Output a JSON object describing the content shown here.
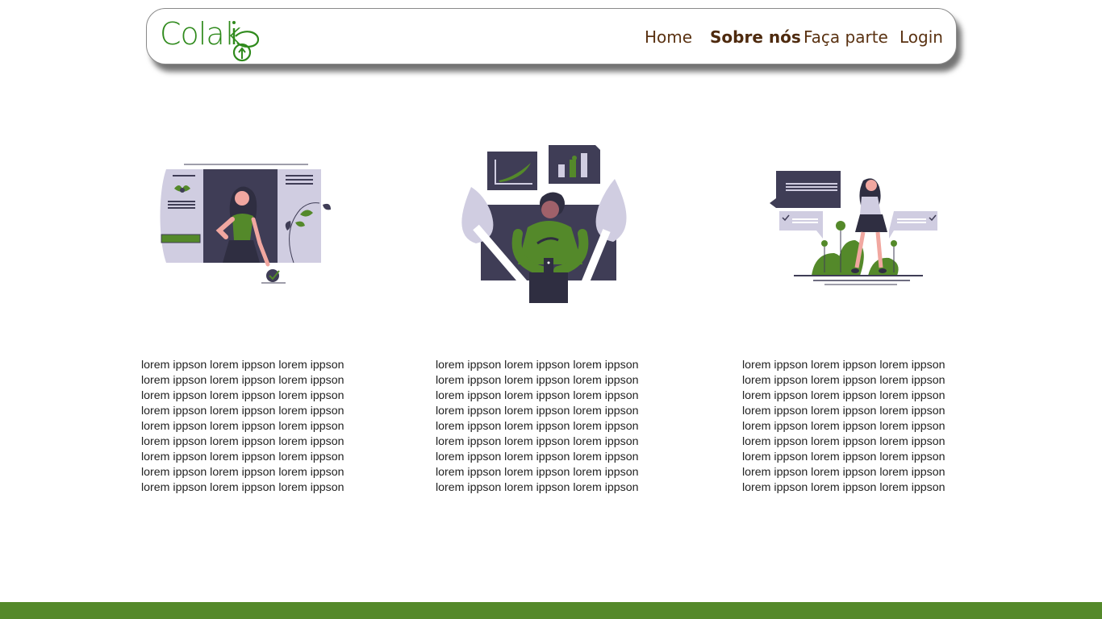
{
  "brand": {
    "name": "Colaki",
    "color": "#2f8a1c"
  },
  "nav": {
    "items": [
      {
        "label": "Home",
        "active": false
      },
      {
        "label": "Sobre nós",
        "active": true
      },
      {
        "label": "Faça parte",
        "active": false
      },
      {
        "label": "Login",
        "active": false
      }
    ]
  },
  "sections": [
    {
      "illustration": "woman-at-window-with-plant",
      "lines": [
        "lorem ippson lorem ippson lorem ippson",
        "lorem ippson lorem ippson lorem ippson",
        "lorem ippson lorem ippson lorem ippson",
        "lorem ippson lorem ippson lorem ippson",
        "lorem ippson lorem ippson lorem ippson",
        "lorem ippson lorem ippson lorem ippson",
        "lorem ippson lorem ippson lorem ippson",
        "lorem ippson lorem ippson lorem ippson",
        "lorem ippson lorem ippson lorem ippson"
      ]
    },
    {
      "illustration": "man-with-phone-and-charts",
      "lines": [
        "lorem ippson lorem ippson lorem ippson",
        "lorem ippson lorem ippson lorem ippson",
        "lorem ippson lorem ippson lorem ippson",
        "lorem ippson lorem ippson lorem ippson",
        "lorem ippson lorem ippson lorem ippson",
        "lorem ippson lorem ippson lorem ippson",
        "lorem ippson lorem ippson lorem ippson",
        "lorem ippson lorem ippson lorem ippson",
        "lorem ippson lorem ippson lorem ippson"
      ]
    },
    {
      "illustration": "woman-with-chat-bubbles",
      "lines": [
        "lorem ippson lorem ippson lorem ippson",
        "lorem ippson lorem ippson lorem ippson",
        "lorem ippson lorem ippson lorem ippson",
        "lorem ippson lorem ippson lorem ippson",
        "lorem ippson lorem ippson lorem ippson",
        "lorem ippson lorem ippson lorem ippson",
        "lorem ippson lorem ippson lorem ippson",
        "lorem ippson lorem ippson lorem ippson",
        "lorem ippson lorem ippson lorem ippson"
      ]
    }
  ],
  "colors": {
    "nav_text": "#5a3212",
    "accent_green": "#54892a",
    "illustration_dark": "#3f3d56",
    "illustration_light": "#d0cde1",
    "footer": "#54892a"
  }
}
